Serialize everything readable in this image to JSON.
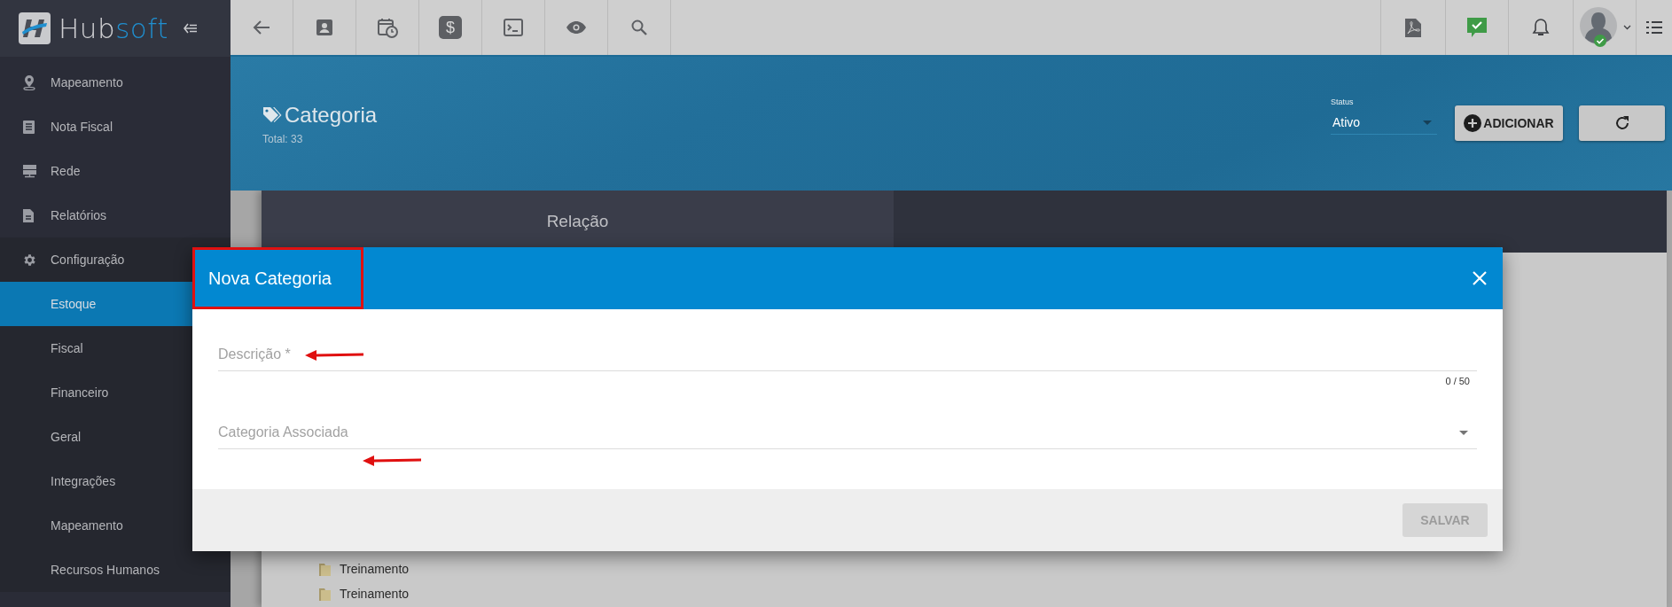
{
  "sidebar": {
    "logo": {
      "part_1": "Hub",
      "part_2": "soft"
    },
    "toolbar": {
      "dollar_icon": "$"
    },
    "items": [
      {
        "label": "Mapeamento",
        "selected": false
      },
      {
        "label": "Nota Fiscal",
        "selected": false
      },
      {
        "label": "Rede",
        "selected": false
      },
      {
        "label": "Relatórios",
        "selected": false
      },
      {
        "label": "Configuração",
        "selected": false,
        "expanded": true,
        "children": [
          {
            "label": "Estoque",
            "selected": true
          },
          {
            "label": "Fiscal",
            "selected": false
          },
          {
            "label": "Financeiro",
            "selected": false
          },
          {
            "label": "Geral",
            "selected": false
          },
          {
            "label": "Integrações",
            "selected": false
          },
          {
            "label": "Mapeamento",
            "selected": false
          },
          {
            "label": "Recursos Humanos",
            "selected": false
          }
        ]
      }
    ]
  },
  "header": {
    "title": "Categoria",
    "total": "Total: 33",
    "status": {
      "label": "Status",
      "value": "Ativo"
    },
    "add_button": "ADICIONAR"
  },
  "tabs": [
    {
      "label": "Relação",
      "selected": true
    }
  ],
  "tree": {
    "items": [
      {
        "label": "Treinamento"
      },
      {
        "label": "Treinamento"
      }
    ]
  },
  "modal": {
    "title": "Nova Categoria",
    "fields": [
      {
        "kind": "text",
        "placeholder": "Descrição *",
        "counter": "0 / 50"
      },
      {
        "kind": "select",
        "placeholder": "Categoria Associada"
      }
    ],
    "save_button": {
      "label": "SALVAR",
      "disabled": true
    }
  }
}
